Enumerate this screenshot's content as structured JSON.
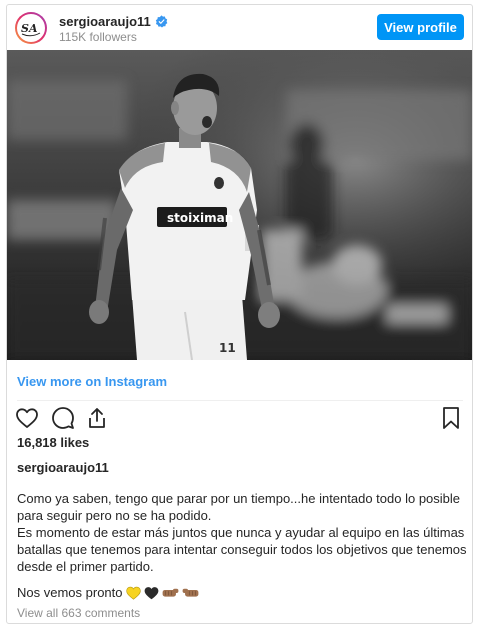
{
  "header": {
    "username": "sergioaraujo11",
    "followers": "115K followers",
    "view_profile_label": "View profile",
    "verified_icon": "verified-badge-icon"
  },
  "post": {
    "view_more_label": "View more on Instagram",
    "likes": "16,818 likes",
    "author": "sergioaraujo11",
    "caption_line1": "Como ya saben, tengo que parar por un tiempo...he intentado todo lo posible para seguir pero no se ha podido.",
    "caption_line2": "Es momento de estar más juntos que nunca y ayudar al equipo en las últimas batallas que tenemos para intentar conseguir todos los objetivos que tenemos desde el primer partido.",
    "closing_text": "Nos vemos pronto",
    "closing_emojis": [
      "yellow-heart-icon",
      "black-heart-icon",
      "fist-right-icon",
      "fist-left-icon"
    ],
    "comments_label": "View all 663 comments"
  },
  "photo": {
    "jersey_sponsor": "stoiximan",
    "jersey_number": "11"
  },
  "colors": {
    "accent": "#0095f6",
    "link": "#3897f0",
    "text": "#262626",
    "muted": "#8e8e8e"
  }
}
